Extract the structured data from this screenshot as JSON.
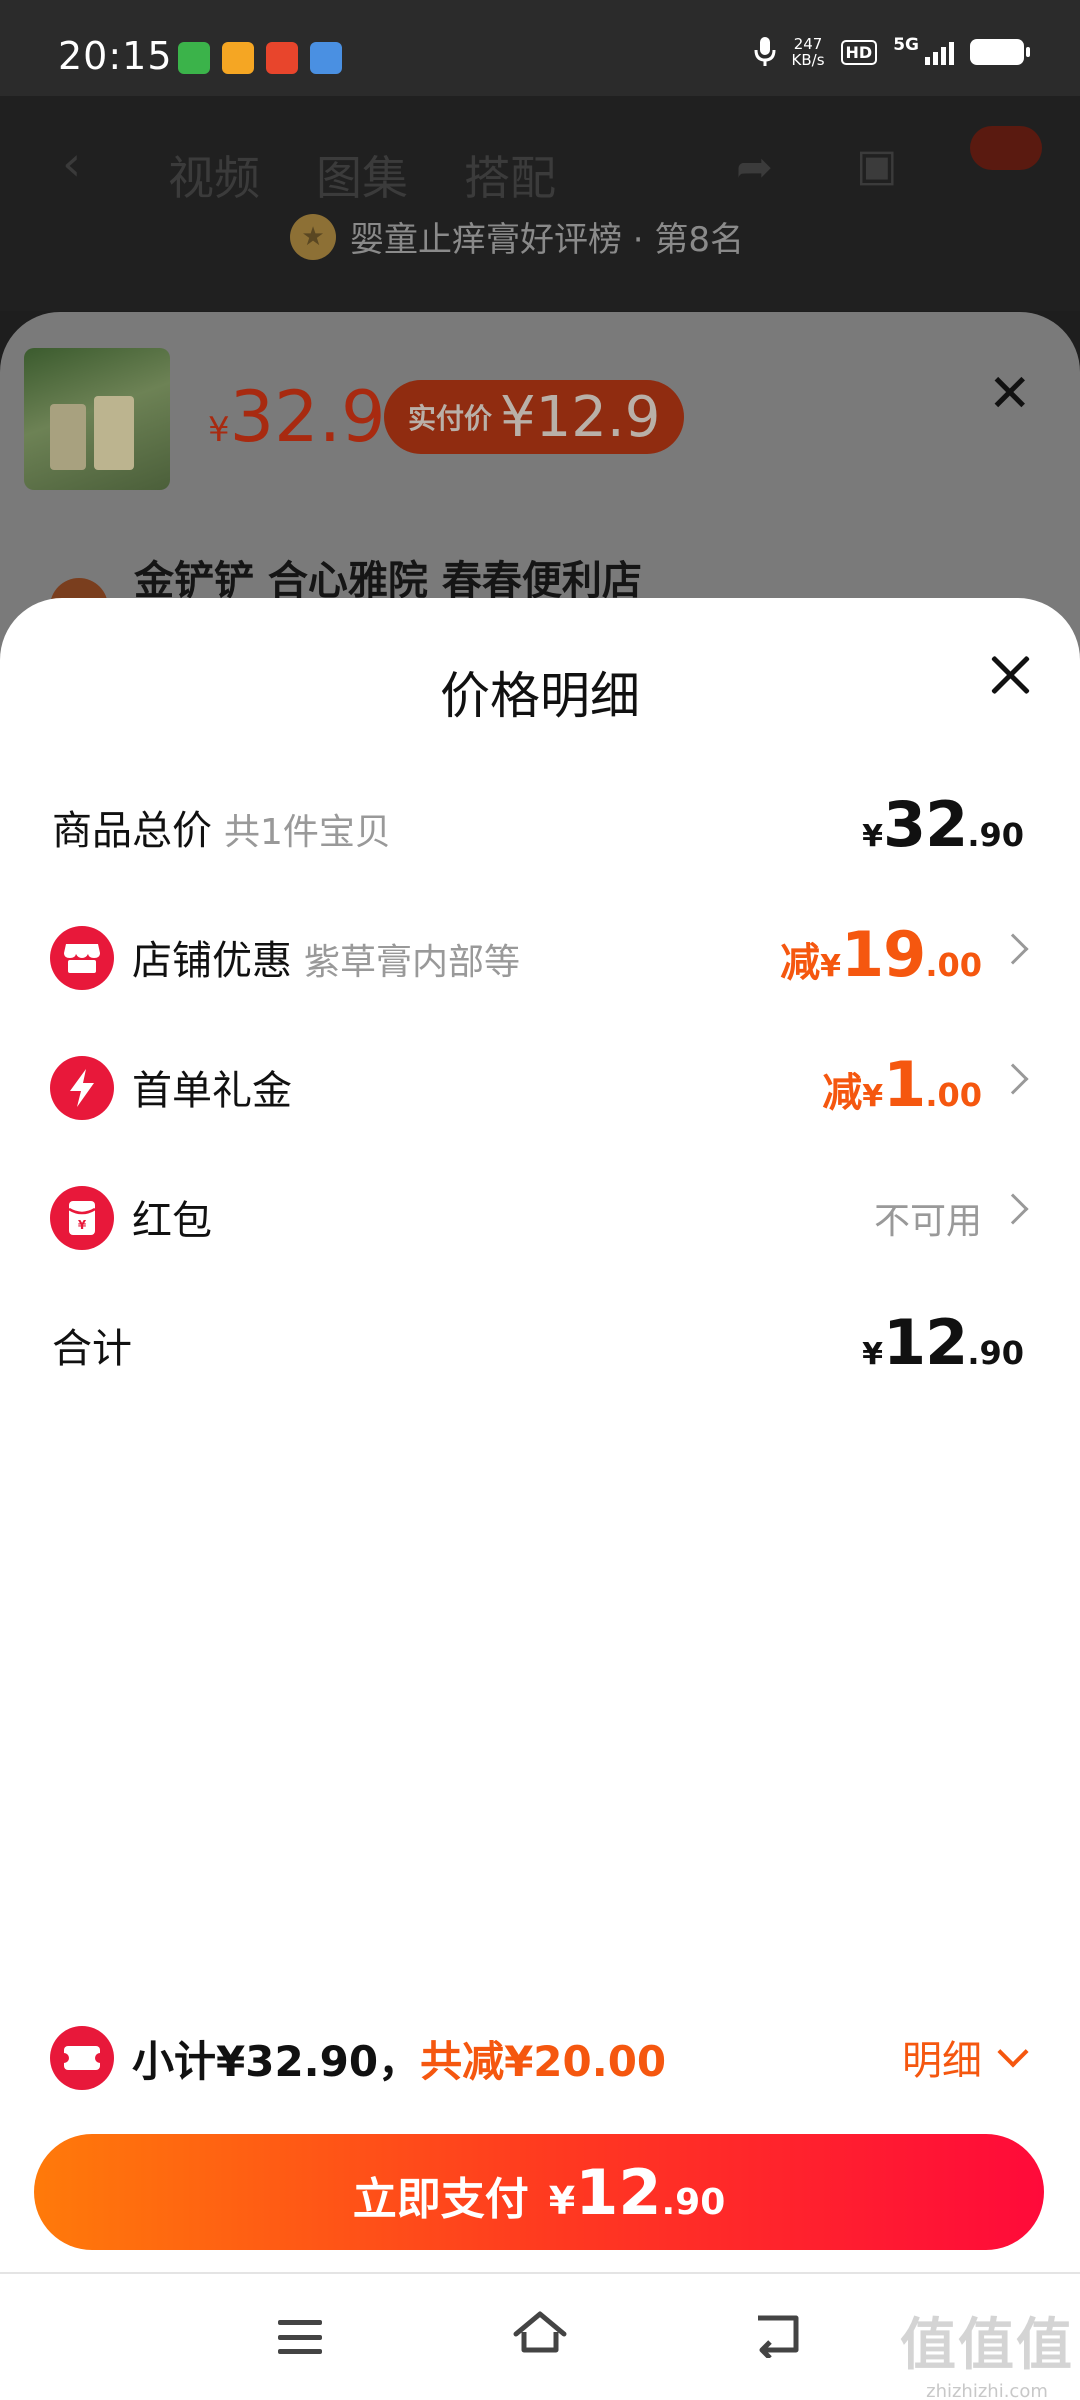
{
  "status_bar": {
    "time": "20:15",
    "net_speed": "247",
    "net_unit": "KB/s",
    "hd": "HD",
    "network": "5G",
    "app_icon_colors": [
      "#3bb34a",
      "#f5a623",
      "#e8452c",
      "#4a90e2"
    ]
  },
  "background_page": {
    "tabs": [
      "视频",
      "图集",
      "搭配"
    ],
    "rank_text": "婴童止痒膏好评榜 · 第8名",
    "price_yen": "¥",
    "price": "32.9",
    "real_pay_label": "实付价",
    "real_pay_value": "¥12.9",
    "store_name": "金铲铲 合心雅院 春春便利店"
  },
  "sheet": {
    "title": "价格明细",
    "rows": [
      {
        "label": "商品总价",
        "sub": "共1件宝贝",
        "yen": "¥",
        "int": "32",
        "dec": ".90"
      },
      {
        "label": "店铺优惠",
        "sub": "紫草膏内部等",
        "prefix": "减",
        "yen": "¥",
        "int": "19",
        "dec": ".00",
        "icon": "store-icon"
      },
      {
        "label": "首单礼金",
        "prefix": "减",
        "yen": "¥",
        "int": "1",
        "dec": ".00",
        "icon": "lightning-icon"
      },
      {
        "label": "红包",
        "value_text": "不可用",
        "icon": "red-packet-icon"
      },
      {
        "label": "合计",
        "yen": "¥",
        "int": "12",
        "dec": ".90"
      }
    ]
  },
  "summary": {
    "subtotal_text": "小计¥32.90，",
    "saved_text": "共减¥20.00",
    "detail_label": "明细"
  },
  "pay_button": {
    "label": "立即支付",
    "yen": "¥",
    "int": "12",
    "dec": ".90"
  },
  "watermark": {
    "big": "值值值",
    "small": "zhizhizhi.com"
  },
  "colors": {
    "accent_orange": "#f5570f",
    "accent_red": "#e8183a"
  }
}
